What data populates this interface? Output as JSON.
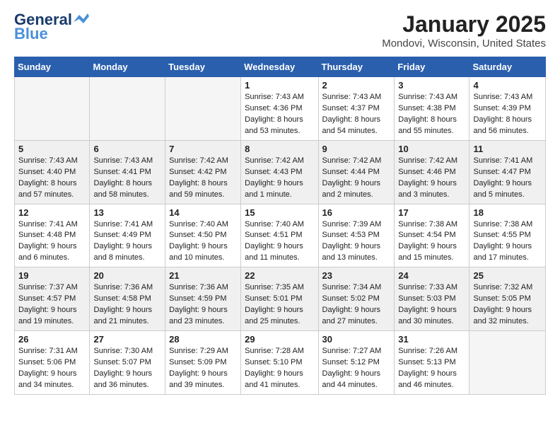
{
  "header": {
    "logo_line1": "General",
    "logo_line2": "Blue",
    "month": "January 2025",
    "location": "Mondovi, Wisconsin, United States"
  },
  "days_of_week": [
    "Sunday",
    "Monday",
    "Tuesday",
    "Wednesday",
    "Thursday",
    "Friday",
    "Saturday"
  ],
  "weeks": [
    [
      {
        "num": "",
        "info": ""
      },
      {
        "num": "",
        "info": ""
      },
      {
        "num": "",
        "info": ""
      },
      {
        "num": "1",
        "info": "Sunrise: 7:43 AM\nSunset: 4:36 PM\nDaylight: 8 hours\nand 53 minutes."
      },
      {
        "num": "2",
        "info": "Sunrise: 7:43 AM\nSunset: 4:37 PM\nDaylight: 8 hours\nand 54 minutes."
      },
      {
        "num": "3",
        "info": "Sunrise: 7:43 AM\nSunset: 4:38 PM\nDaylight: 8 hours\nand 55 minutes."
      },
      {
        "num": "4",
        "info": "Sunrise: 7:43 AM\nSunset: 4:39 PM\nDaylight: 8 hours\nand 56 minutes."
      }
    ],
    [
      {
        "num": "5",
        "info": "Sunrise: 7:43 AM\nSunset: 4:40 PM\nDaylight: 8 hours\nand 57 minutes."
      },
      {
        "num": "6",
        "info": "Sunrise: 7:43 AM\nSunset: 4:41 PM\nDaylight: 8 hours\nand 58 minutes."
      },
      {
        "num": "7",
        "info": "Sunrise: 7:42 AM\nSunset: 4:42 PM\nDaylight: 8 hours\nand 59 minutes."
      },
      {
        "num": "8",
        "info": "Sunrise: 7:42 AM\nSunset: 4:43 PM\nDaylight: 9 hours\nand 1 minute."
      },
      {
        "num": "9",
        "info": "Sunrise: 7:42 AM\nSunset: 4:44 PM\nDaylight: 9 hours\nand 2 minutes."
      },
      {
        "num": "10",
        "info": "Sunrise: 7:42 AM\nSunset: 4:46 PM\nDaylight: 9 hours\nand 3 minutes."
      },
      {
        "num": "11",
        "info": "Sunrise: 7:41 AM\nSunset: 4:47 PM\nDaylight: 9 hours\nand 5 minutes."
      }
    ],
    [
      {
        "num": "12",
        "info": "Sunrise: 7:41 AM\nSunset: 4:48 PM\nDaylight: 9 hours\nand 6 minutes."
      },
      {
        "num": "13",
        "info": "Sunrise: 7:41 AM\nSunset: 4:49 PM\nDaylight: 9 hours\nand 8 minutes."
      },
      {
        "num": "14",
        "info": "Sunrise: 7:40 AM\nSunset: 4:50 PM\nDaylight: 9 hours\nand 10 minutes."
      },
      {
        "num": "15",
        "info": "Sunrise: 7:40 AM\nSunset: 4:51 PM\nDaylight: 9 hours\nand 11 minutes."
      },
      {
        "num": "16",
        "info": "Sunrise: 7:39 AM\nSunset: 4:53 PM\nDaylight: 9 hours\nand 13 minutes."
      },
      {
        "num": "17",
        "info": "Sunrise: 7:38 AM\nSunset: 4:54 PM\nDaylight: 9 hours\nand 15 minutes."
      },
      {
        "num": "18",
        "info": "Sunrise: 7:38 AM\nSunset: 4:55 PM\nDaylight: 9 hours\nand 17 minutes."
      }
    ],
    [
      {
        "num": "19",
        "info": "Sunrise: 7:37 AM\nSunset: 4:57 PM\nDaylight: 9 hours\nand 19 minutes."
      },
      {
        "num": "20",
        "info": "Sunrise: 7:36 AM\nSunset: 4:58 PM\nDaylight: 9 hours\nand 21 minutes."
      },
      {
        "num": "21",
        "info": "Sunrise: 7:36 AM\nSunset: 4:59 PM\nDaylight: 9 hours\nand 23 minutes."
      },
      {
        "num": "22",
        "info": "Sunrise: 7:35 AM\nSunset: 5:01 PM\nDaylight: 9 hours\nand 25 minutes."
      },
      {
        "num": "23",
        "info": "Sunrise: 7:34 AM\nSunset: 5:02 PM\nDaylight: 9 hours\nand 27 minutes."
      },
      {
        "num": "24",
        "info": "Sunrise: 7:33 AM\nSunset: 5:03 PM\nDaylight: 9 hours\nand 30 minutes."
      },
      {
        "num": "25",
        "info": "Sunrise: 7:32 AM\nSunset: 5:05 PM\nDaylight: 9 hours\nand 32 minutes."
      }
    ],
    [
      {
        "num": "26",
        "info": "Sunrise: 7:31 AM\nSunset: 5:06 PM\nDaylight: 9 hours\nand 34 minutes."
      },
      {
        "num": "27",
        "info": "Sunrise: 7:30 AM\nSunset: 5:07 PM\nDaylight: 9 hours\nand 36 minutes."
      },
      {
        "num": "28",
        "info": "Sunrise: 7:29 AM\nSunset: 5:09 PM\nDaylight: 9 hours\nand 39 minutes."
      },
      {
        "num": "29",
        "info": "Sunrise: 7:28 AM\nSunset: 5:10 PM\nDaylight: 9 hours\nand 41 minutes."
      },
      {
        "num": "30",
        "info": "Sunrise: 7:27 AM\nSunset: 5:12 PM\nDaylight: 9 hours\nand 44 minutes."
      },
      {
        "num": "31",
        "info": "Sunrise: 7:26 AM\nSunset: 5:13 PM\nDaylight: 9 hours\nand 46 minutes."
      },
      {
        "num": "",
        "info": ""
      }
    ]
  ]
}
